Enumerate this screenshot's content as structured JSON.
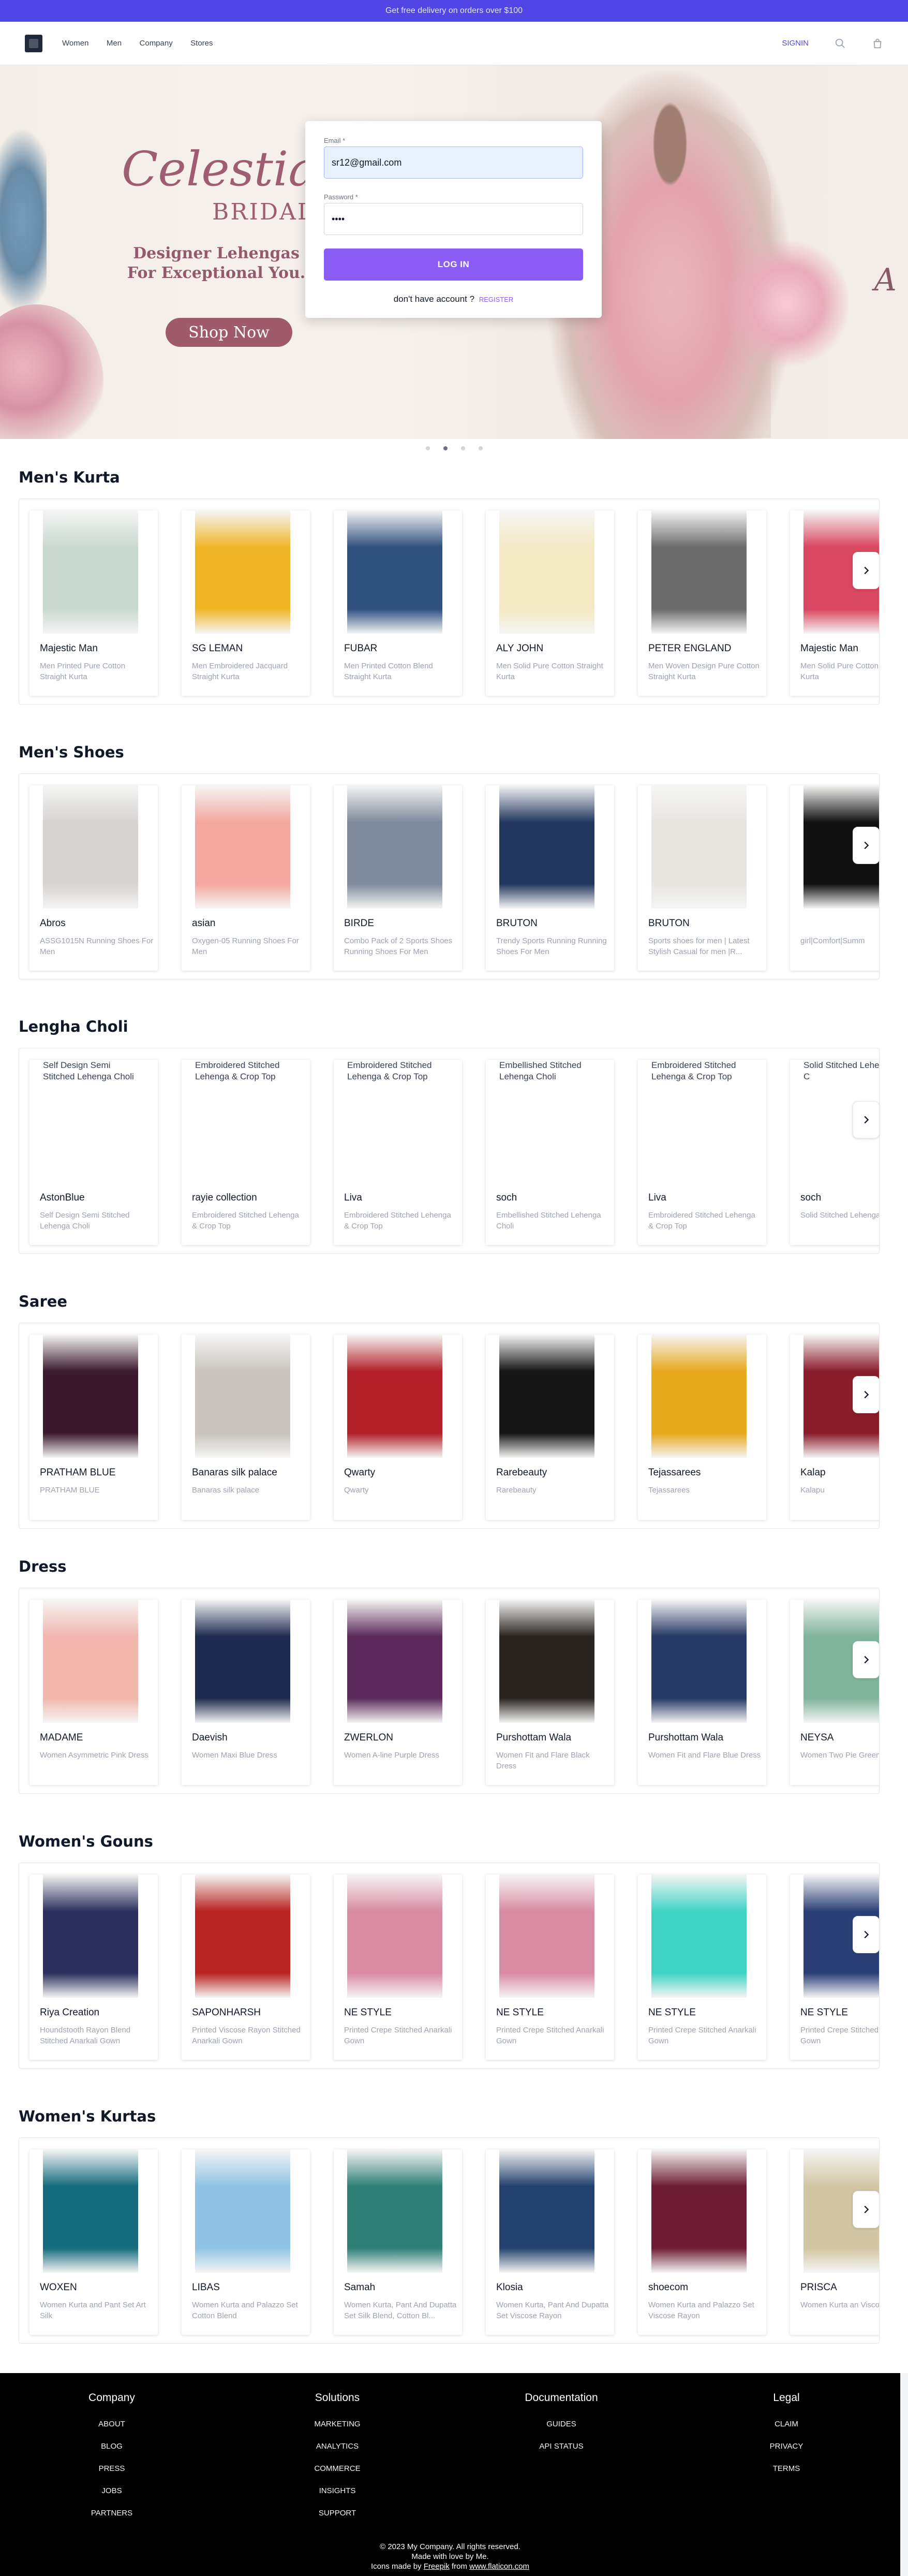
{
  "promo": "Get free delivery on orders over $100",
  "header": {
    "nav": [
      "Women",
      "Men",
      "Company",
      "Stores"
    ],
    "signin": "SIGNIN",
    "icons": [
      "search-icon",
      "shopping-bag-icon"
    ]
  },
  "hero": {
    "title": "Celestial",
    "subtitle": "BRIDAL",
    "tagline": "Designer Lehengas For Exceptional You.",
    "cta": "Shop Now",
    "right_letter": "A"
  },
  "login": {
    "email_label": "Email *",
    "email_value": "sr12@gmail.com",
    "password_label": "Password *",
    "password_value": "••••",
    "submit": "LOG IN",
    "no_account": "don't have account ?",
    "register": "REGISTER"
  },
  "carousel_dots": {
    "count": 4,
    "active": 1
  },
  "sections": [
    {
      "title": "Men's Kurta",
      "products": [
        {
          "brand": "Majestic Man",
          "desc": "Men Printed Pure Cotton Straight Kurta",
          "color": "#c9d8cf"
        },
        {
          "brand": "SG LEMAN",
          "desc": "Men Embroidered Jacquard Straight Kurta",
          "color": "#f0b527"
        },
        {
          "brand": "FUBAR",
          "desc": "Men Printed Cotton Blend Straight Kurta",
          "color": "#2f4f7f"
        },
        {
          "brand": "ALY JOHN",
          "desc": "Men Solid Pure Cotton Straight Kurta",
          "color": "#f3e9c4"
        },
        {
          "brand": "PETER ENGLAND",
          "desc": "Men Woven Design Pure Cotton Straight Kurta",
          "color": "#6b6b6b"
        },
        {
          "brand": "Majestic Man",
          "desc": "Men Solid Pure Cotton Straight Kurta",
          "color": "#d9465f"
        }
      ]
    },
    {
      "title": "Men's Shoes",
      "products": [
        {
          "brand": "Abros",
          "desc": "ASSG1015N Running Shoes For Men",
          "color": "#d6d3d1"
        },
        {
          "brand": "asian",
          "desc": "Oxygen-05 Running Shoes For Men",
          "color": "#f4a7a0"
        },
        {
          "brand": "BIRDE",
          "desc": "Combo Pack of 2 Sports Shoes Running Shoes For Men",
          "color": "#7f8a9c"
        },
        {
          "brand": "BRUTON",
          "desc": "Trendy Sports Running Running Shoes For Men",
          "color": "#23365f"
        },
        {
          "brand": "BRUTON",
          "desc": "Sports shoes for men | Latest Stylish Casual for men |R...",
          "color": "#e8e5e1"
        },
        {
          "brand": "",
          "desc": "girl|Comfort|Summ",
          "color": "#111111"
        }
      ]
    },
    {
      "title": "Lengha Choli",
      "products": [
        {
          "brand": "AstonBlue",
          "desc": "Self Design Semi Stitched Lehenga Choli",
          "alt": "Self Design Semi Stitched Lehenga Choli"
        },
        {
          "brand": "rayie collection",
          "desc": "Embroidered Stitched Lehenga & Crop Top",
          "alt": "Embroidered Stitched Lehenga & Crop Top"
        },
        {
          "brand": "Liva",
          "desc": "Embroidered Stitched Lehenga & Crop Top",
          "alt": "Embroidered Stitched Lehenga & Crop Top"
        },
        {
          "brand": "soch",
          "desc": "Embellished Stitched Lehenga Choli",
          "alt": "Embellished Stitched Lehenga Choli"
        },
        {
          "brand": "Liva",
          "desc": "Embroidered Stitched Lehenga & Crop Top",
          "alt": "Embroidered Stitched Lehenga & Crop Top"
        },
        {
          "brand": "soch",
          "desc": "Solid Stitched Lehenga C",
          "alt": "Solid Stitched Lehenga C"
        }
      ]
    },
    {
      "title": "Saree",
      "products": [
        {
          "brand": "PRATHAM BLUE",
          "desc": "PRATHAM BLUE",
          "color": "#3b1a2e"
        },
        {
          "brand": "Banaras silk palace",
          "desc": "Banaras silk palace",
          "color": "#c9c4bd"
        },
        {
          "brand": "Qwarty",
          "desc": "Qwarty",
          "color": "#b3202a"
        },
        {
          "brand": "Rarebeauty",
          "desc": "Rarebeauty",
          "color": "#161616"
        },
        {
          "brand": "Tejassarees",
          "desc": "Tejassarees",
          "color": "#e6a81c"
        },
        {
          "brand": "Kalap",
          "desc": "Kalapu",
          "color": "#8a1c2a"
        }
      ]
    },
    {
      "title": "Dress",
      "products": [
        {
          "brand": "MADAME",
          "desc": "Women Asymmetric Pink Dress",
          "color": "#f2b6ad"
        },
        {
          "brand": "Daevish",
          "desc": "Women Maxi Blue Dress",
          "color": "#1e2a4f"
        },
        {
          "brand": "ZWERLON",
          "desc": "Women A-line Purple Dress",
          "color": "#5b2a5a"
        },
        {
          "brand": "Purshottam Wala",
          "desc": "Women Fit and Flare Black Dress",
          "color": "#2a2420"
        },
        {
          "brand": "Purshottam Wala",
          "desc": "Women Fit and Flare Blue Dress",
          "color": "#263866"
        },
        {
          "brand": "NEYSA",
          "desc": "Women Two Pie Green Dress",
          "color": "#7fb39b"
        }
      ]
    },
    {
      "title": "Women's Gouns",
      "products": [
        {
          "brand": "Riya Creation",
          "desc": "Houndstooth Rayon Blend Stitched Anarkali Gown",
          "color": "#2c2f5e"
        },
        {
          "brand": "SAPONHARSH",
          "desc": "Printed Viscose Rayon Stitched Anarkali Gown",
          "color": "#b8241f"
        },
        {
          "brand": "NE STYLE",
          "desc": "Printed Crepe Stitched Anarkali Gown",
          "color": "#d98aa3"
        },
        {
          "brand": "NE STYLE",
          "desc": "Printed Crepe Stitched Anarkali Gown",
          "color": "#d98aa3"
        },
        {
          "brand": "NE STYLE",
          "desc": "Printed Crepe Stitched Anarkali Gown",
          "color": "#3fd3c4"
        },
        {
          "brand": "NE STYLE",
          "desc": "Printed Crepe Stitched Anarkali Gown",
          "color": "#2b3f77"
        }
      ]
    },
    {
      "title": "Women's Kurtas",
      "products": [
        {
          "brand": "WOXEN",
          "desc": "Women Kurta and Pant Set Art Silk",
          "color": "#136b7d"
        },
        {
          "brand": "LIBAS",
          "desc": "Women Kurta and Palazzo Set Cotton Blend",
          "color": "#8fc3e6"
        },
        {
          "brand": "Samah",
          "desc": "Women Kurta, Pant And Dupatta Set Silk Blend, Cotton Bl...",
          "color": "#2f7f78"
        },
        {
          "brand": "Klosia",
          "desc": "Women Kurta, Pant And Dupatta Set Viscose Rayon",
          "color": "#23406e"
        },
        {
          "brand": "shoecom",
          "desc": "Women Kurta and Palazzo Set Viscose Rayon",
          "color": "#6d1c34"
        },
        {
          "brand": "PRISCA",
          "desc": "Women Kurta an Viscose Rayon",
          "color": "#d2c5a3"
        }
      ]
    }
  ],
  "footer": {
    "columns": [
      {
        "title": "Company",
        "links": [
          "ABOUT",
          "BLOG",
          "PRESS",
          "JOBS",
          "PARTNERS"
        ]
      },
      {
        "title": "Solutions",
        "links": [
          "MARKETING",
          "ANALYTICS",
          "COMMERCE",
          "INSIGHTS",
          "SUPPORT"
        ]
      },
      {
        "title": "Documentation",
        "links": [
          "GUIDES",
          "API STATUS"
        ]
      },
      {
        "title": "Legal",
        "links": [
          "CLAIM",
          "PRIVACY",
          "TERMS"
        ]
      }
    ],
    "copyright": "© 2023 My Company. All rights reserved.",
    "made_with": "Made with love by Me.",
    "icons_credit_prefix": "Icons made by",
    "freepik": "Freepik",
    "from": "from",
    "flaticon": "www.flaticon.com"
  }
}
